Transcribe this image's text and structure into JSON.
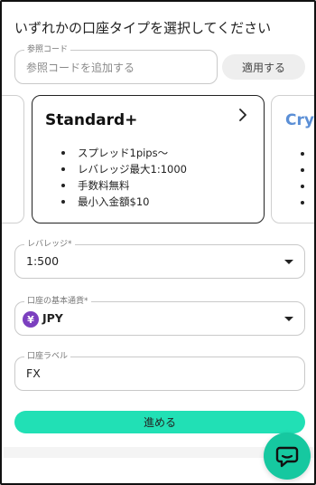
{
  "page": {
    "title": "いずれかの口座タイプを選択してください"
  },
  "referral": {
    "label": "参照コード",
    "placeholder": "参照コードを追加する",
    "apply_label": "適用する"
  },
  "account_cards": {
    "selected": {
      "title": "Standard+",
      "features": [
        "スプレッド1pips〜",
        "レバレッジ最大1:1000",
        "手数料無料",
        "最小入金額$10"
      ]
    },
    "next_peek": {
      "title": "Cry"
    }
  },
  "leverage": {
    "label": "レバレッジ*",
    "value": "1:500"
  },
  "currency": {
    "label": "口座の基本通貨*",
    "icon": "yen-icon",
    "icon_glyph": "¥",
    "value": "JPY"
  },
  "account_label": {
    "label": "口座ラベル",
    "value": "FX"
  },
  "actions": {
    "proceed_label": "進める"
  },
  "colors": {
    "accent": "#21e0b5",
    "chat": "#16c8a0",
    "currency_icon": "#7b3fbf",
    "peek_title": "#5b8fd6"
  }
}
